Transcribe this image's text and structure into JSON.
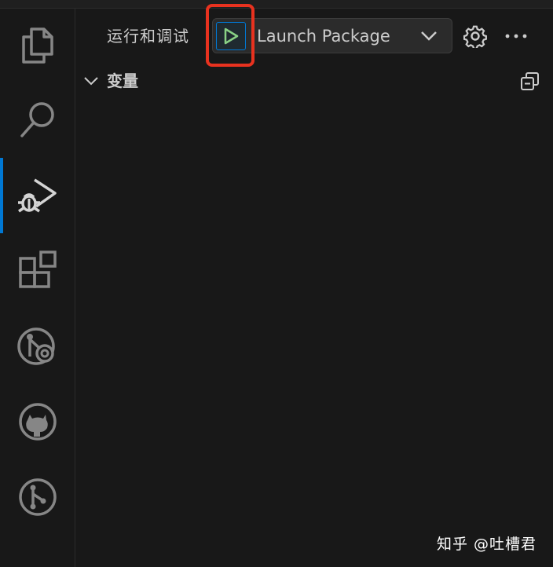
{
  "activity_bar": {
    "items": [
      {
        "icon": "explorer-icon"
      },
      {
        "icon": "search-icon"
      },
      {
        "icon": "run-and-debug-icon",
        "active": true
      },
      {
        "icon": "extensions-icon"
      },
      {
        "icon": "remote-explorer-icon"
      },
      {
        "icon": "github-icon"
      },
      {
        "icon": "source-control-graph-icon"
      }
    ]
  },
  "sidebar": {
    "title": "运行和调试",
    "run_config": {
      "label": "Launch Package",
      "run_icon": "play-icon",
      "dropdown_icon": "chevron-down-icon"
    },
    "gear_icon": "gear-icon",
    "more_icon": "ellipsis-icon",
    "section": {
      "title": "变量",
      "chevron_icon": "chevron-down-icon",
      "action_icon": "collapse-all-icon"
    }
  },
  "watermark": "知乎 @吐槽君",
  "colors": {
    "background": "#181818",
    "accent": "#0078d4",
    "run_green": "#89d185",
    "highlight": "#e8321f",
    "text": "#cccccc"
  }
}
